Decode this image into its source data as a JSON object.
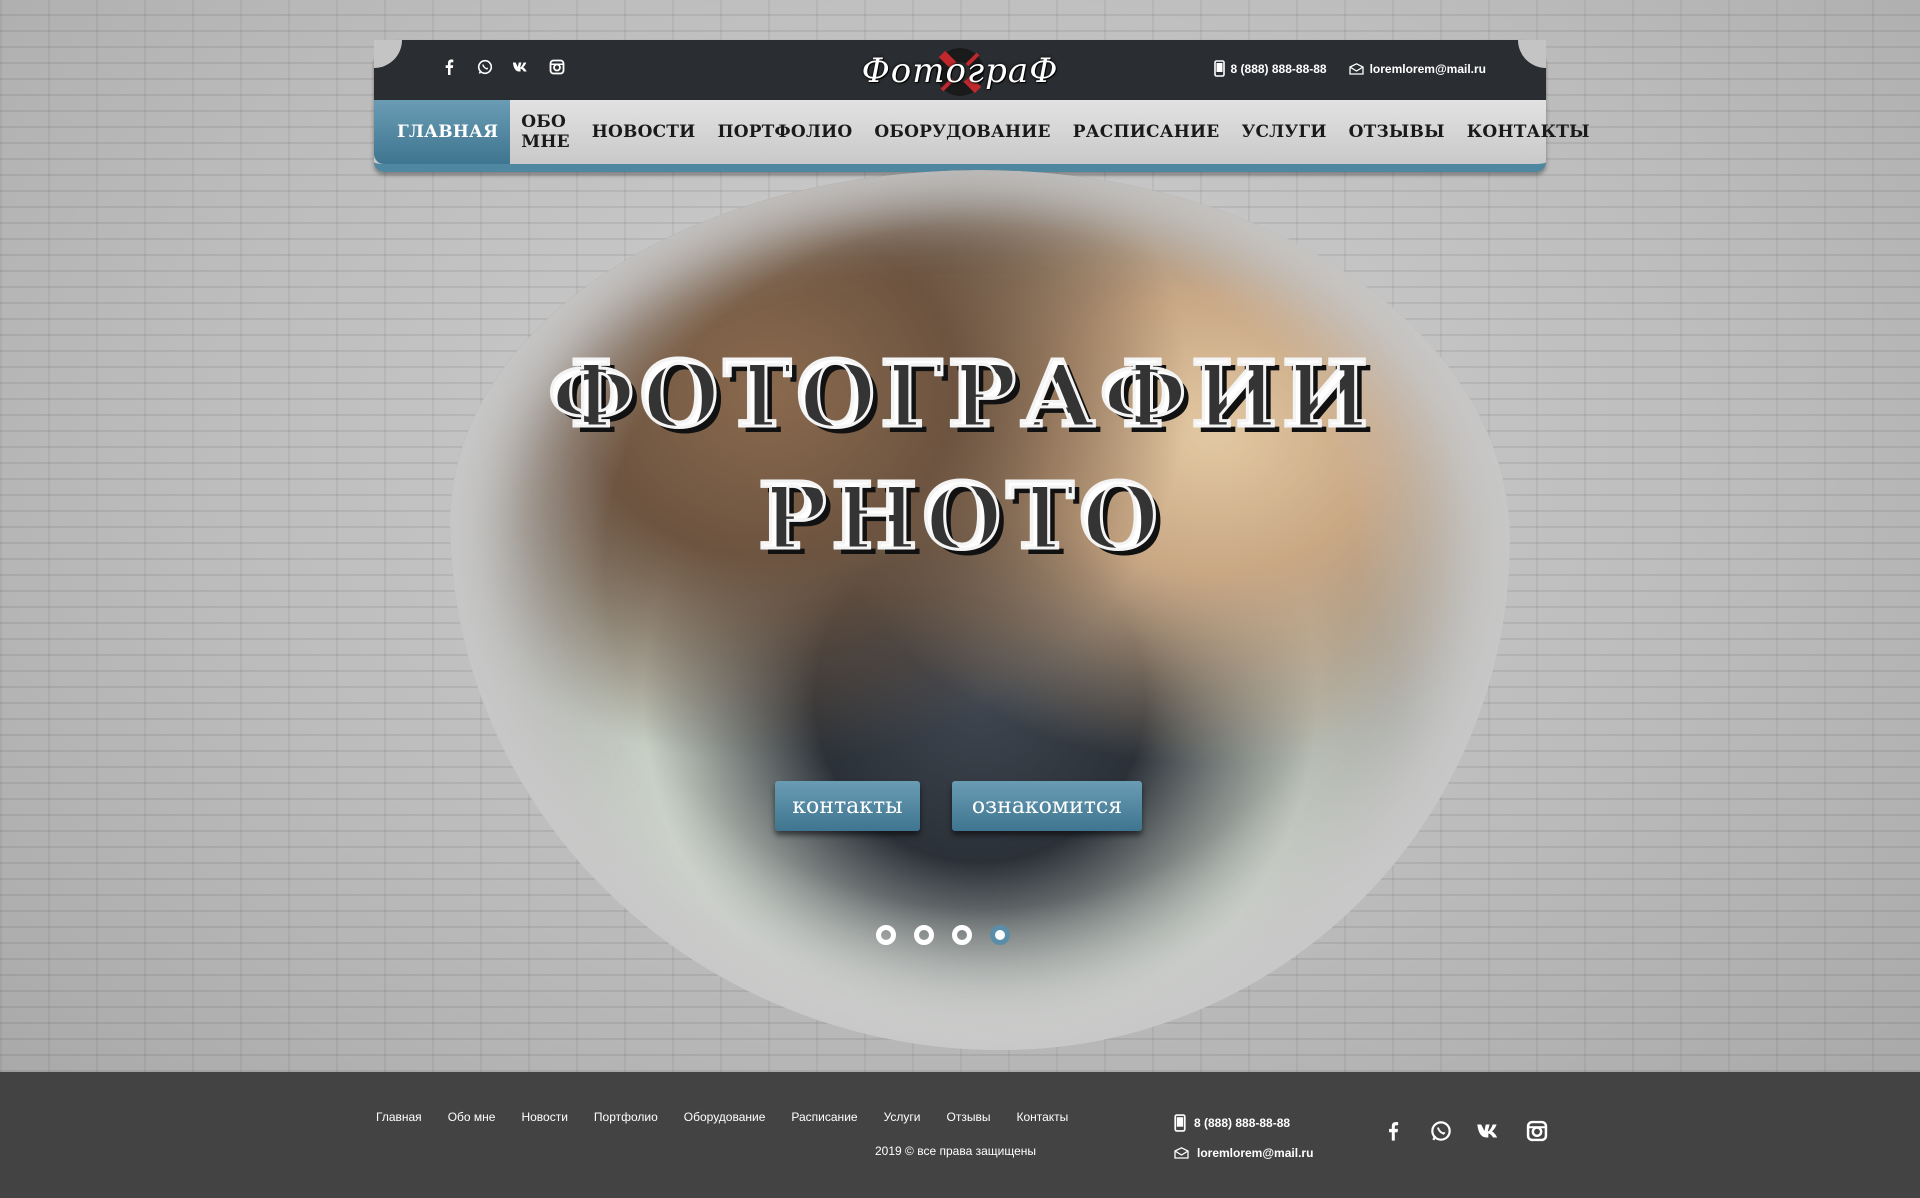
{
  "header": {
    "logo_text": "ФотограФ",
    "social": [
      "facebook-icon",
      "whatsapp-icon",
      "vk-icon",
      "instagram-icon"
    ],
    "phone": "8 (888) 888-88-88",
    "email": "loremlorem@mail.ru"
  },
  "menu": {
    "items": [
      {
        "label": "ГЛАВНАЯ",
        "active": true
      },
      {
        "label": "ОБО МНЕ"
      },
      {
        "label": "НОВОСТИ"
      },
      {
        "label": "ПОРТФОЛИО"
      },
      {
        "label": "ОБОРУДОВАНИЕ"
      },
      {
        "label": "РАСПИСАНИЕ"
      },
      {
        "label": "УСЛУГИ"
      },
      {
        "label": "ОТЗЫВЫ"
      },
      {
        "label": "КОНТАКТЫ"
      }
    ]
  },
  "hero": {
    "title_line1": "ФОТОГРАФИИ",
    "title_line2": "PHOTO",
    "button_contacts": "контакты",
    "button_learn": "ознакомится",
    "slides_total": 4,
    "slide_active": 4
  },
  "colors": {
    "accent": "#4f86a0",
    "topbar": "#2a2d31",
    "footer": "#434343"
  },
  "footer": {
    "menu": [
      "Главная",
      "Обо мне",
      "Новости",
      "Портфолио",
      "Оборудование",
      "Расписание",
      "Услуги",
      "Отзывы",
      "Контакты"
    ],
    "copyright_year": "2019",
    "copyright_symbol": "©",
    "copyright_text": "все права защищены",
    "phone": "8 (888) 888-88-88",
    "email": "loremlorem@mail.ru"
  }
}
